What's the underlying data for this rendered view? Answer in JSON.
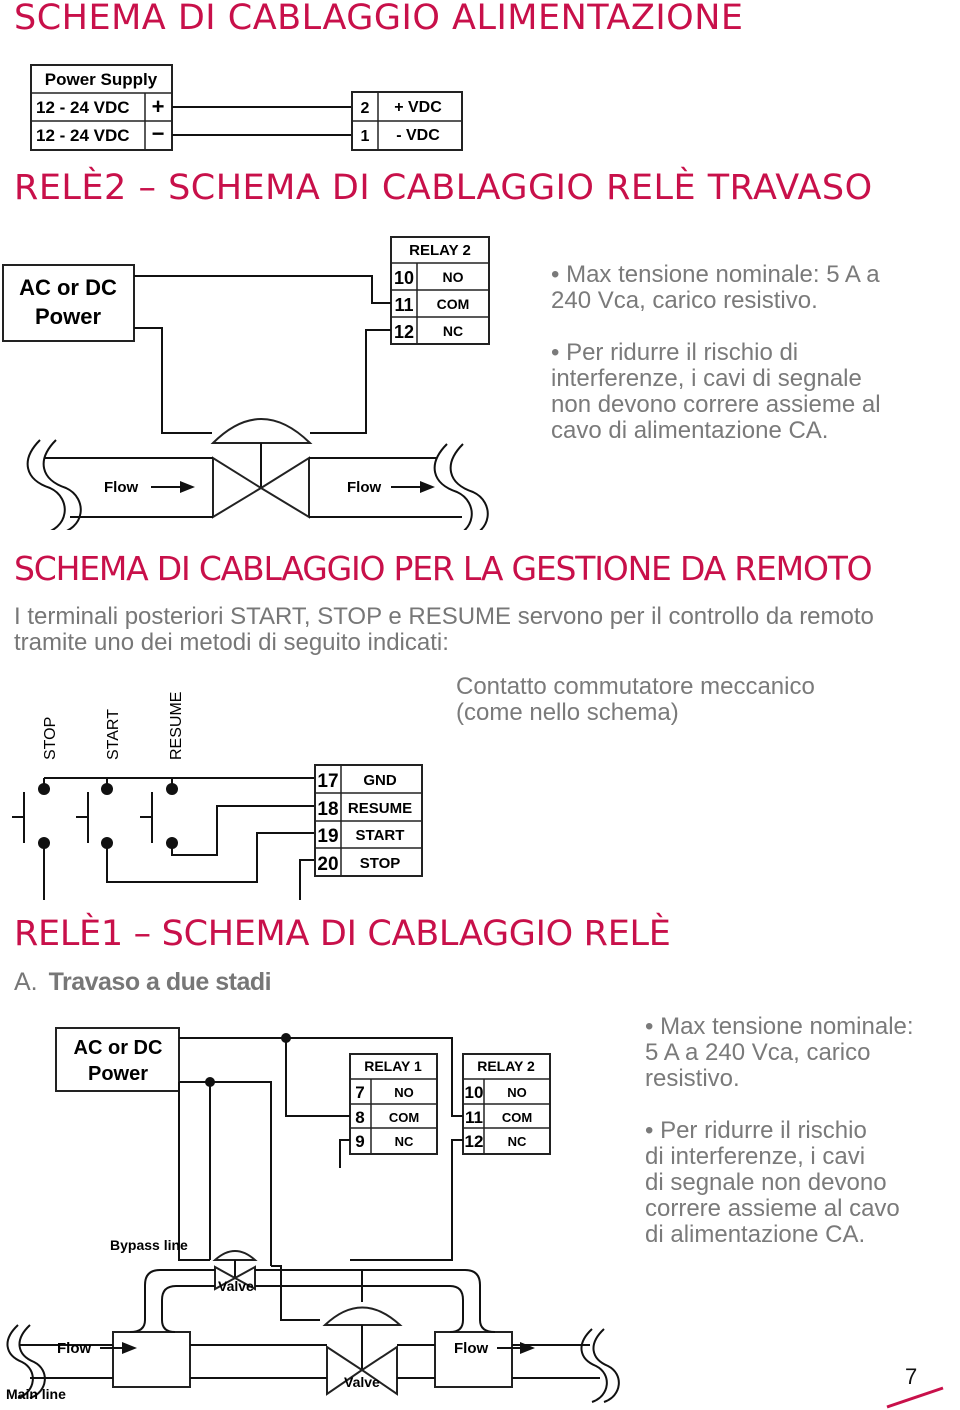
{
  "section1": {
    "title": "SCHEMA DI CABLAGGIO ALIMENTAZIONE",
    "power_supply": {
      "header": "Power Supply",
      "rows": [
        {
          "label": "12 - 24 VDC",
          "sign": "+"
        },
        {
          "label": "12 - 24 VDC",
          "sign": "−"
        }
      ]
    },
    "terminal": {
      "rows": [
        {
          "num": "2",
          "label": "+ VDC"
        },
        {
          "num": "1",
          "label": "- VDC"
        }
      ]
    }
  },
  "section2": {
    "title": "RELÈ2 – SCHEMA DI CABLAGGIO RELÈ TRAVASO",
    "power_box": {
      "line1": "AC or DC",
      "line2": "Power"
    },
    "relay": {
      "header": "RELAY 2",
      "rows": [
        {
          "num": "10",
          "label": "NO"
        },
        {
          "num": "11",
          "label": "COM"
        },
        {
          "num": "12",
          "label": "NC"
        }
      ]
    },
    "notes": [
      "• Max tensione nominale: 5 A a\n240 Vca, carico resistivo.",
      "• Per ridurre il rischio di\ninterferenze, i cavi di segnale\nnon devono correre assieme al\ncavo di alimentazione CA."
    ],
    "flow_labels": [
      "Flow",
      "Flow"
    ]
  },
  "section3": {
    "title": "SCHEMA DI CABLAGGIO PER LA GESTIONE DA REMOTO",
    "intro": "I terminali posteriori START, STOP e RESUME servono per il controllo da remoto tramite uno dei metodi di seguito indicati:",
    "caption": "Contatto commutatore meccanico\n(come nello schema)",
    "switches": [
      "STOP",
      "START",
      "RESUME"
    ],
    "terminal": {
      "rows": [
        {
          "num": "17",
          "label": "GND"
        },
        {
          "num": "18",
          "label": "RESUME"
        },
        {
          "num": "19",
          "label": "START"
        },
        {
          "num": "20",
          "label": "STOP"
        }
      ]
    }
  },
  "section4": {
    "title": "RELÈ1 – SCHEMA DI CABLAGGIO RELÈ",
    "subtitle_prefix": "A.",
    "subtitle": "Travaso a due stadi",
    "power_box": {
      "line1": "AC or DC",
      "line2": "Power"
    },
    "relay1": {
      "header": "RELAY 1",
      "rows": [
        {
          "num": "7",
          "label": "NO"
        },
        {
          "num": "8",
          "label": "COM"
        },
        {
          "num": "9",
          "label": "NC"
        }
      ]
    },
    "relay2": {
      "header": "RELAY 2",
      "rows": [
        {
          "num": "10",
          "label": "NO"
        },
        {
          "num": "11",
          "label": "COM"
        },
        {
          "num": "12",
          "label": "NC"
        }
      ]
    },
    "notes": [
      "• Max tensione nominale:\n5 A a 240 Vca, carico\nresistivo.",
      "• Per ridurre il rischio\ndi interferenze, i cavi\ndi segnale non devono\ncorrere assieme al cavo\ndi alimentazione CA."
    ],
    "diagram_labels": {
      "bypass_line": "Bypass line",
      "bypass_valve": "Valve",
      "main_valve": "Valve",
      "flow_left": "Flow",
      "flow_right": "Flow",
      "main_line": "Main line"
    }
  },
  "footer": {
    "page_number": "7",
    "accent_color": "#c8104a"
  }
}
